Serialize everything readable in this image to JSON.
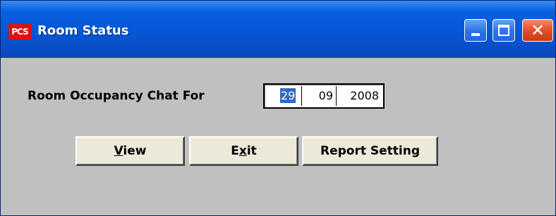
{
  "window": {
    "app_icon_text": "PCS",
    "title": "Room Status",
    "controls": {
      "minimize": "minimize-icon",
      "maximize": "maximize-icon",
      "close": "close-icon"
    }
  },
  "form": {
    "label": "Room Occupancy Chat For",
    "date": {
      "day": "29",
      "month": "09",
      "year": "2008"
    }
  },
  "buttons": {
    "view": {
      "label_prefix": "",
      "mnemonic": "V",
      "label_rest": "iew"
    },
    "exit": {
      "label_prefix": "E",
      "mnemonic": "x",
      "label_rest": "it"
    },
    "report": {
      "label": "Report Setting"
    }
  },
  "colors": {
    "titlebar": "#0558d6",
    "client_bg": "#c0c0c0",
    "selection": "#316ac5",
    "close_button": "#e0502c"
  }
}
